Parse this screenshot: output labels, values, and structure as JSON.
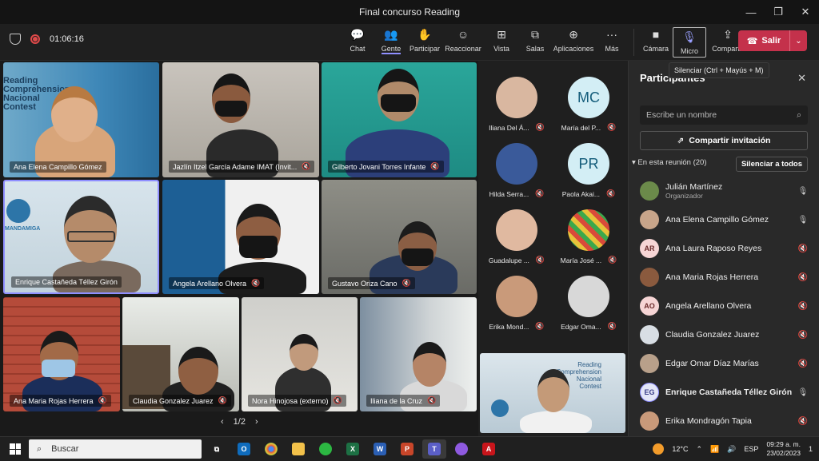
{
  "window": {
    "title": "Final concurso Reading"
  },
  "toolbar": {
    "timer": "01:06:16",
    "buttons": [
      {
        "label": "Chat",
        "icon": "chat-icon"
      },
      {
        "label": "Gente",
        "icon": "people-icon"
      },
      {
        "label": "Participar",
        "icon": "hand-icon"
      },
      {
        "label": "Reaccionar",
        "icon": "smile-icon"
      },
      {
        "label": "Vista",
        "icon": "grid-icon"
      },
      {
        "label": "Salas",
        "icon": "rooms-icon"
      },
      {
        "label": "Aplicaciones",
        "icon": "apps-icon"
      },
      {
        "label": "Más",
        "icon": "more-icon"
      },
      {
        "label": "Cámara",
        "icon": "camera-icon"
      },
      {
        "label": "Micro",
        "icon": "mic-icon"
      },
      {
        "label": "Compartir",
        "icon": "share-icon"
      }
    ],
    "leave_label": "Salir",
    "tooltip": "Silenciar (Ctrl + Mayús + M)"
  },
  "grid": {
    "tiles": [
      {
        "name": "Ana Elena Campillo Gómez",
        "muted": false
      },
      {
        "name": "Jazlín Itzel García Adame IMAT (Invit...",
        "muted": true
      },
      {
        "name": "Gilberto Jovani Torres Infante",
        "muted": true
      },
      {
        "name": "Enrique Castañeda Téllez Girón",
        "muted": false
      },
      {
        "name": "Angela Arellano Olvera",
        "muted": true
      },
      {
        "name": "Gustavo Oriza Cano",
        "muted": true
      },
      {
        "name": "Ana Maria Rojas Herrera",
        "muted": true
      },
      {
        "name": "Claudia Gonzalez Juarez",
        "muted": true
      },
      {
        "name": "Nora Hinojosa (externo)",
        "muted": true
      },
      {
        "name": "Iliana de la Cruz",
        "muted": true
      }
    ],
    "slide_text": [
      "Reading",
      "Comprehension",
      "Nacional",
      "Contest"
    ],
    "slide_logo": "MANDAMIGA",
    "page": "1/2"
  },
  "side_gallery": [
    {
      "name": "Iliana Del Á...",
      "initials": ""
    },
    {
      "name": "María del P...",
      "initials": "MC"
    },
    {
      "name": "Hilda Serra...",
      "initials": ""
    },
    {
      "name": "Paola Akai...",
      "initials": "PR"
    },
    {
      "name": "Guadalupe ...",
      "initials": ""
    },
    {
      "name": "María José ...",
      "initials": ""
    },
    {
      "name": "Erika Mond...",
      "initials": ""
    },
    {
      "name": "Edgar Oma...",
      "initials": ""
    }
  ],
  "panel": {
    "title": "Participantes",
    "search_placeholder": "Escribe un nombre",
    "share_label": "Compartir invitación",
    "section_label": "En esta reunión (20)",
    "mute_all_label": "Silenciar a todos",
    "participants": [
      {
        "name": "Julián Martínez",
        "role": "Organizador",
        "initials": "",
        "mic": "on"
      },
      {
        "name": "Ana Elena Campillo Gómez",
        "role": "",
        "initials": "",
        "mic": "on"
      },
      {
        "name": "Ana Laura Raposo Reyes",
        "role": "",
        "initials": "AR",
        "mic": "off"
      },
      {
        "name": "Ana Maria Rojas Herrera",
        "role": "",
        "initials": "",
        "mic": "off"
      },
      {
        "name": "Angela Arellano Olvera",
        "role": "",
        "initials": "AO",
        "mic": "off"
      },
      {
        "name": "Claudia Gonzalez Juarez",
        "role": "",
        "initials": "",
        "mic": "off"
      },
      {
        "name": "Edgar Omar Díaz Marías",
        "role": "",
        "initials": "",
        "mic": "off"
      },
      {
        "name": "Enrique Castañeda Téllez Girón",
        "role": "",
        "initials": "EG",
        "mic": "on"
      },
      {
        "name": "Erika Mondragón Tapia",
        "role": "",
        "initials": "",
        "mic": "off"
      }
    ]
  },
  "taskbar": {
    "search_label": "Buscar",
    "weather": "12°C",
    "language": "ESP",
    "time": "09:29 a. m.",
    "date": "23/02/2023",
    "notification_count": "1"
  }
}
